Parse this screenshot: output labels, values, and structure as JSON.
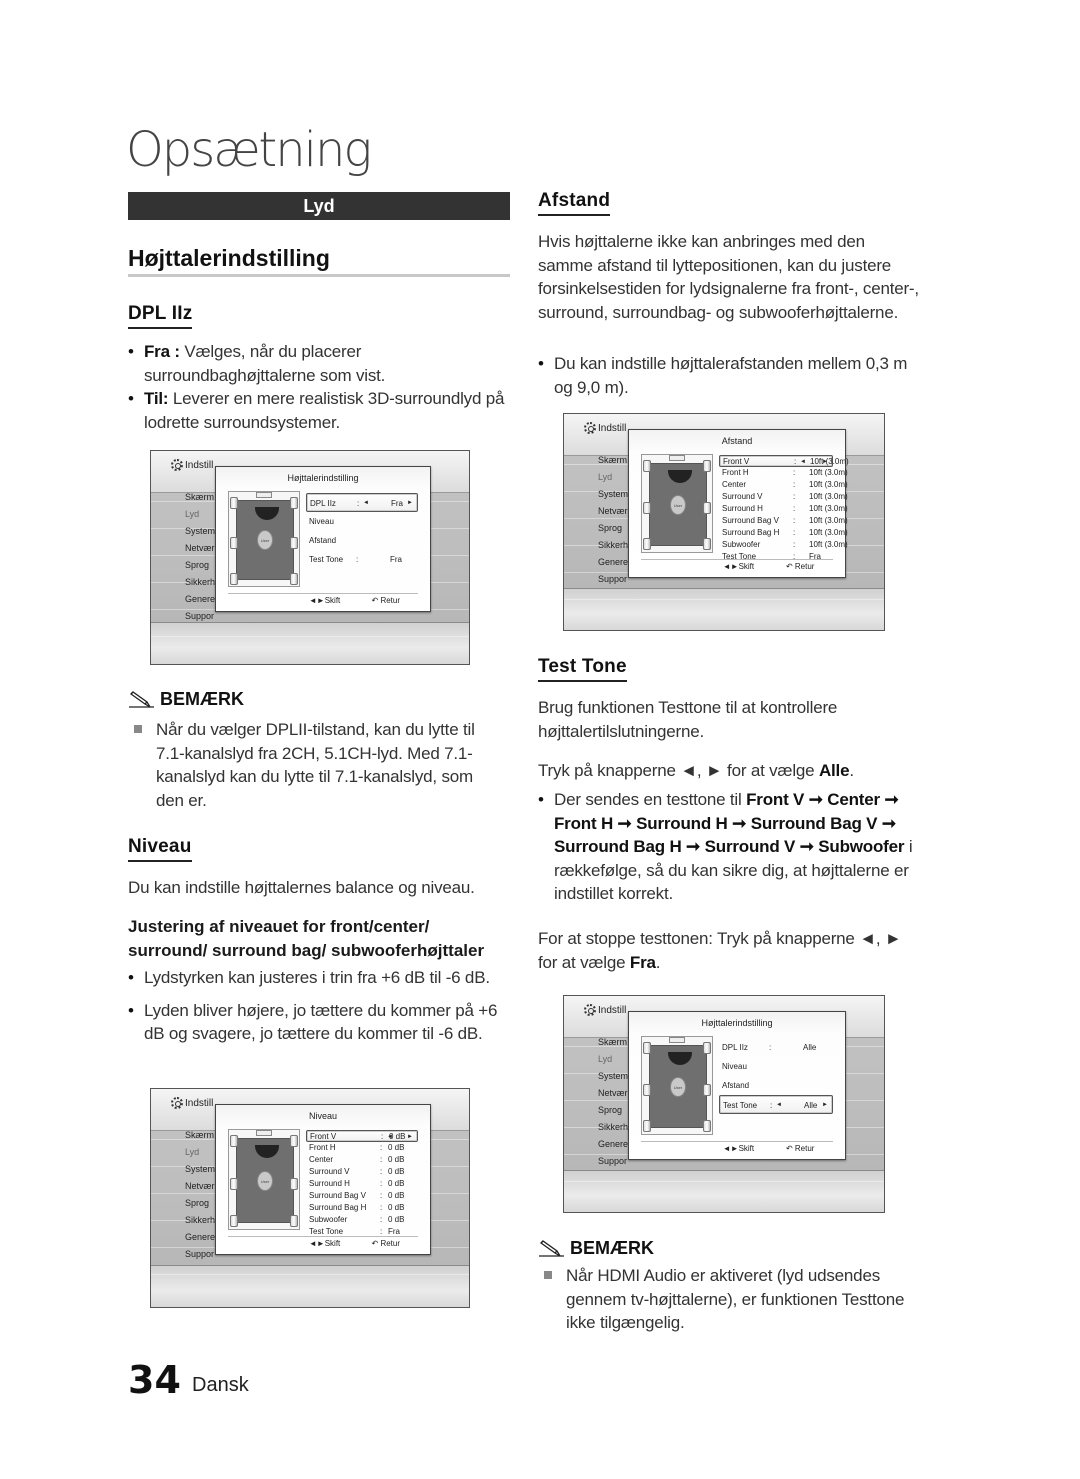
{
  "page": {
    "title": "Opsætning",
    "section": "Lyd",
    "page_number": "34",
    "language": "Dansk"
  },
  "left": {
    "heading": "Højttalerindstilling",
    "dpl": {
      "title": "DPL IIz",
      "bullets": [
        {
          "bold": "Fra :",
          "text": " Vælges, når du placerer surroundbaghøjttalerne som vist."
        },
        {
          "bold": "Til:",
          "text": " Leverer en mere realistisk 3D-surroundlyd på lodrette surroundsystemer."
        }
      ]
    },
    "note": {
      "label": "BEMÆRK",
      "text": "Når du vælger DPLII-tilstand, kan du lytte til 7.1-kanalslyd fra 2CH, 5.1CH-lyd. Med 7.1-kanalslyd kan du lytte til 7.1-kanalslyd, som den er."
    },
    "niveau": {
      "title": "Niveau",
      "intro": "Du kan indstille højttalernes balance og niveau.",
      "subhead": "Justering af niveauet for front/center/ surround/ surround bag/ subwooferhøjttaler",
      "bullets": [
        "Lydstyrken kan justeres i trin fra +6 dB til -6 dB.",
        "Lyden bliver højere, jo tættere du kommer på +6 dB og svagere, jo tættere du kommer til -6 dB."
      ]
    }
  },
  "right": {
    "afstand": {
      "title": "Afstand",
      "intro": "Hvis højttalerne ikke kan anbringes med den samme afstand til lyttepositionen, kan du justere forsinkelsestiden for lydsignalerne fra front-, center-, surround, surroundbag- og subwooferhøjttalerne.",
      "bullet": "Du kan indstille højttalerafstanden mellem 0,3 m og 9,0 m)."
    },
    "testtone": {
      "title": "Test Tone",
      "intro": "Brug funktionen Testtone til at kontrollere højttalertilslutningerne.",
      "press_pre": "Tryk på knapperne ◄, ► for at vælge ",
      "press_bold": "Alle",
      "press_post": ".",
      "bullet_pre": "Der sendes en testtone til ",
      "bullet_bold": "Front V ➞ Center ➞ Front H ➞ Surround H ➞ Surround Bag V ➞ Surround Bag H ➞ Surround V ➞ Subwoofer",
      "bullet_post": " i rækkefølge, så du kan sikre dig, at højttalerne er indstillet korrekt.",
      "stop_pre": "For at stoppe testtonen: Tryk på knapperne ◄, ► for at vælge ",
      "stop_bold": "Fra",
      "stop_post": "."
    },
    "note": {
      "label": "BEMÆRK",
      "text": "Når HDMI Audio er aktiveret (lyd udsendes gennem tv-højttalerne), er funktionen Testtone ikke tilgængelig."
    }
  },
  "screens": {
    "common": {
      "header": "Indstill",
      "menu": [
        "Skærm",
        "Lyd",
        "System",
        "Netvær",
        "Sprog",
        "Sikkerh",
        "Genere",
        "Suppor"
      ],
      "skift": "◄►Skift",
      "retur": "Retur",
      "user_label": "User"
    },
    "speaker_setting": {
      "title": "Højttalerindstilling",
      "rows": [
        {
          "label": "DPL IIz",
          "sep": ":",
          "value": "Fra",
          "selected": true
        },
        {
          "label": "Niveau",
          "sep": "",
          "value": ""
        },
        {
          "label": "Afstand",
          "sep": "",
          "value": ""
        },
        {
          "label": "Test Tone",
          "sep": ":",
          "value": "Fra"
        }
      ]
    },
    "distance": {
      "title": "Afstand",
      "rows": [
        {
          "label": "Front V",
          "sep": ":",
          "value": "10ft (3.0m)",
          "selected": true
        },
        {
          "label": "Front H",
          "sep": ":",
          "value": "10ft (3.0m)"
        },
        {
          "label": "Center",
          "sep": ":",
          "value": "10ft (3.0m)"
        },
        {
          "label": "Surround V",
          "sep": ":",
          "value": "10ft (3.0m)"
        },
        {
          "label": "Surround H",
          "sep": ":",
          "value": "10ft (3.0m)"
        },
        {
          "label": "Surround Bag V",
          "sep": ":",
          "value": "10ft (3.0m)"
        },
        {
          "label": "Surround Bag H",
          "sep": ":",
          "value": "10ft (3.0m)"
        },
        {
          "label": "Subwoofer",
          "sep": ":",
          "value": "10ft (3.0m)"
        },
        {
          "label": "Test Tone",
          "sep": ":",
          "value": "Fra"
        }
      ]
    },
    "level": {
      "title": "Niveau",
      "rows": [
        {
          "label": "Front V",
          "sep": ":",
          "value": "0 dB",
          "selected": true
        },
        {
          "label": "Front H",
          "sep": ":",
          "value": "0 dB"
        },
        {
          "label": "Center",
          "sep": ":",
          "value": "0 dB"
        },
        {
          "label": "Surround V",
          "sep": ":",
          "value": "0 dB"
        },
        {
          "label": "Surround H",
          "sep": ":",
          "value": "0 dB"
        },
        {
          "label": "Surround Bag V",
          "sep": ":",
          "value": "0 dB"
        },
        {
          "label": "Surround Bag H",
          "sep": ":",
          "value": "0 dB"
        },
        {
          "label": "Subwoofer",
          "sep": ":",
          "value": "0 dB"
        },
        {
          "label": "Test Tone",
          "sep": ":",
          "value": "Fra"
        }
      ]
    },
    "testtone": {
      "title": "Højttalerindstilling",
      "rows": [
        {
          "label": "DPL IIz",
          "sep": ":",
          "value": "Alle"
        },
        {
          "label": "Niveau",
          "sep": "",
          "value": ""
        },
        {
          "label": "Afstand",
          "sep": "",
          "value": ""
        },
        {
          "label": "Test Tone",
          "sep": ":",
          "value": "Alle",
          "selected": true
        }
      ]
    }
  }
}
